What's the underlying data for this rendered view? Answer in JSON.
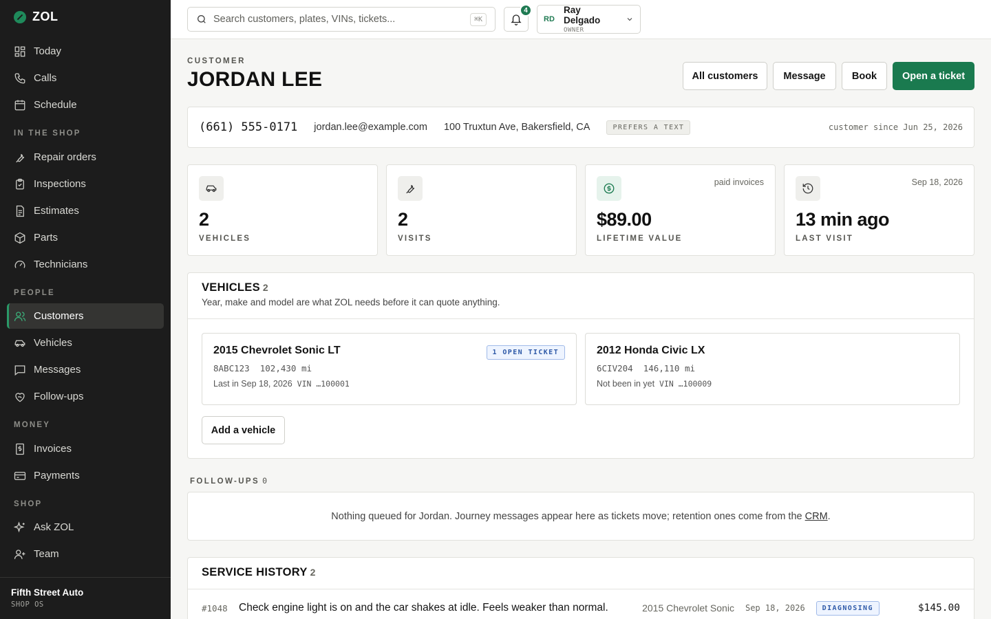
{
  "brand": {
    "name": "ZOL"
  },
  "nav": {
    "top": [
      {
        "label": "Today",
        "icon": "grid-icon"
      },
      {
        "label": "Calls",
        "icon": "phone-icon"
      },
      {
        "label": "Schedule",
        "icon": "calendar-icon"
      }
    ],
    "sections": [
      {
        "label": "IN THE SHOP",
        "items": [
          {
            "label": "Repair orders",
            "icon": "wrench-icon"
          },
          {
            "label": "Inspections",
            "icon": "clipboard-icon"
          },
          {
            "label": "Estimates",
            "icon": "document-icon"
          },
          {
            "label": "Parts",
            "icon": "box-icon"
          },
          {
            "label": "Technicians",
            "icon": "gauge-icon"
          }
        ]
      },
      {
        "label": "PEOPLE",
        "items": [
          {
            "label": "Customers",
            "icon": "users-icon",
            "active": true
          },
          {
            "label": "Vehicles",
            "icon": "car-icon"
          },
          {
            "label": "Messages",
            "icon": "message-icon"
          },
          {
            "label": "Follow-ups",
            "icon": "heart-hand-icon"
          }
        ]
      },
      {
        "label": "MONEY",
        "items": [
          {
            "label": "Invoices",
            "icon": "invoice-icon"
          },
          {
            "label": "Payments",
            "icon": "card-icon"
          }
        ]
      },
      {
        "label": "SHOP",
        "items": [
          {
            "label": "Ask ZOL",
            "icon": "sparkle-icon"
          },
          {
            "label": "Team",
            "icon": "user-plus-icon"
          }
        ]
      }
    ],
    "footer": {
      "shop_name": "Fifth Street Auto",
      "shop_sub": "SHOP OS"
    }
  },
  "topbar": {
    "search_placeholder": "Search customers, plates, VINs, tickets...",
    "search_shortcut": "⌘K",
    "notification_count": "4",
    "user": {
      "initials": "RD",
      "name": "Ray Delgado",
      "role": "OWNER"
    }
  },
  "page": {
    "eyebrow": "CUSTOMER",
    "title": "JORDAN LEE",
    "buttons": {
      "all_customers": "All customers",
      "message": "Message",
      "book": "Book",
      "open_ticket": "Open a ticket"
    }
  },
  "contact": {
    "phone": "(661) 555-0171",
    "email": "jordan.lee@example.com",
    "address": "100 Truxtun Ave, Bakersfield, CA",
    "preference": "PREFERS A TEXT",
    "since": "customer since Jun 25, 2026"
  },
  "stats": [
    {
      "value": "2",
      "label": "VEHICLES",
      "note": "",
      "icon": "car-icon"
    },
    {
      "value": "2",
      "label": "VISITS",
      "note": "",
      "icon": "wrench-icon"
    },
    {
      "value": "$89.00",
      "label": "LIFETIME VALUE",
      "note": "paid invoices",
      "icon": "dollar-icon"
    },
    {
      "value": "13 min ago",
      "label": "LAST VISIT",
      "note": "Sep 18, 2026",
      "icon": "history-icon"
    }
  ],
  "vehicles": {
    "title": "VEHICLES",
    "count": "2",
    "subtitle": "Year, make and model are what ZOL needs before it can quote anything.",
    "items": [
      {
        "name": "2015 Chevrolet Sonic LT",
        "plate": "8ABC123",
        "mileage": "102,430 mi",
        "last": "Last in Sep 18, 2026",
        "vin": "VIN …100001",
        "tag": "1 OPEN TICKET"
      },
      {
        "name": "2012 Honda Civic LX",
        "plate": "6CIV204",
        "mileage": "146,110 mi",
        "last": "Not been in yet",
        "vin": "VIN …100009",
        "tag": ""
      }
    ],
    "add_label": "Add a vehicle"
  },
  "followups": {
    "title": "FOLLOW-UPS",
    "count": "0",
    "empty_text": "Nothing queued for Jordan. Journey messages appear here as tickets move; retention ones come from the ",
    "link": "CRM",
    "end": "."
  },
  "history": {
    "title": "SERVICE HISTORY",
    "count": "2",
    "rows": [
      {
        "number": "#1048",
        "description": "Check engine light is on and the car shakes at idle. Feels weaker than normal.",
        "vehicle": "2015 Chevrolet Sonic",
        "date": "Sep 18, 2026",
        "status": "DIAGNOSING",
        "amount": "$145.00"
      }
    ]
  }
}
